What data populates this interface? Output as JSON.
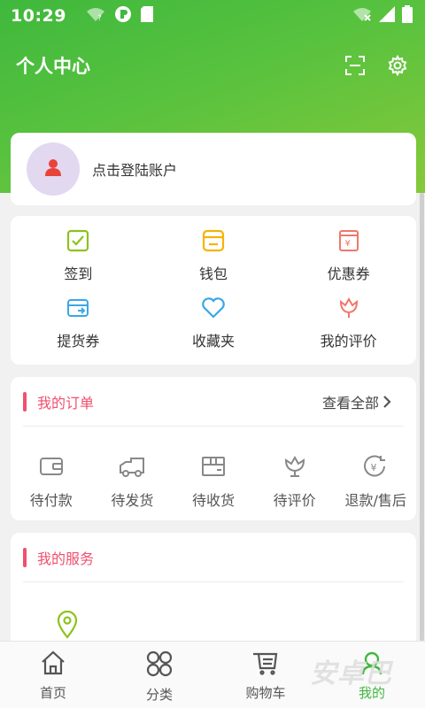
{
  "status_bar": {
    "time": "10:29",
    "left_icons": [
      "wifi-question-icon",
      "app-notification-icon",
      "sim-card-icon"
    ],
    "right_icons": [
      "wifi-off-icon",
      "signal-icon",
      "battery-icon"
    ]
  },
  "header": {
    "title": "个人中心",
    "actions": [
      "scan-icon",
      "settings-gear-icon"
    ],
    "gradient_colors": [
      "#3fb83d",
      "#86c93a"
    ]
  },
  "login": {
    "avatar_icon": "user-avatar-icon",
    "text": "点击登陆账户"
  },
  "quick_links": [
    {
      "label": "签到",
      "icon": "checkin-icon",
      "color": "#8dc21f"
    },
    {
      "label": "钱包",
      "icon": "wallet-icon",
      "color": "#f5b400"
    },
    {
      "label": "优惠券",
      "icon": "coupon-icon",
      "color": "#f0776a"
    },
    {
      "label": "提货券",
      "icon": "pickup-voucher-icon",
      "color": "#3aa7e8"
    },
    {
      "label": "收藏夹",
      "icon": "heart-icon",
      "color": "#3aa7e8"
    },
    {
      "label": "我的评价",
      "icon": "review-flower-icon",
      "color": "#f0776a"
    }
  ],
  "orders": {
    "title": "我的订单",
    "more_label": "查看全部",
    "accent_color": "#f0506e",
    "items": [
      {
        "label": "待付款",
        "icon": "wallet-pay-icon"
      },
      {
        "label": "待发货",
        "icon": "truck-icon"
      },
      {
        "label": "待收货",
        "icon": "package-icon"
      },
      {
        "label": "待评价",
        "icon": "review-icon"
      },
      {
        "label": "退款/售后",
        "icon": "refund-icon"
      }
    ]
  },
  "services": {
    "title": "我的服务",
    "items": [
      {
        "icon": "location-pin-icon",
        "color": "#8dc21f"
      }
    ]
  },
  "tabbar": {
    "active_color": "#3fb83d",
    "items": [
      {
        "label": "首页",
        "icon": "home-icon"
      },
      {
        "label": "分类",
        "icon": "category-grid-icon"
      },
      {
        "label": "购物车",
        "icon": "cart-icon"
      },
      {
        "label": "我的",
        "icon": "profile-icon",
        "active": true
      }
    ]
  },
  "watermark": "安卓巴"
}
